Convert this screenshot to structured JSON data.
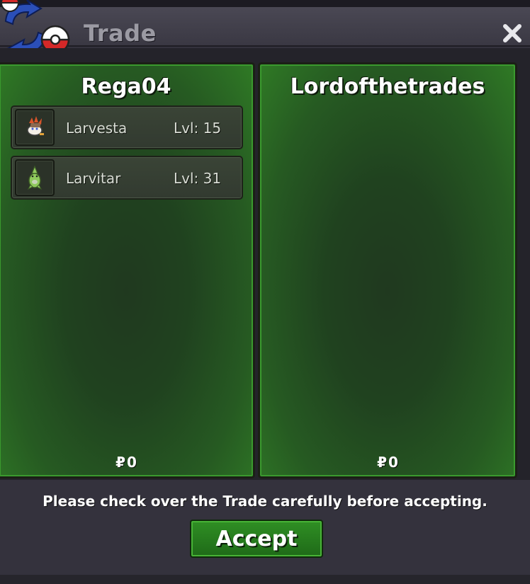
{
  "window": {
    "title": "Trade",
    "close_icon": "close-icon",
    "logo_icon": "trade-exchange-icon"
  },
  "left_panel": {
    "player_name": "Rega04",
    "pokemon": [
      {
        "name": "Larvesta",
        "level": "Lvl: 15",
        "icon": "larvesta-sprite-icon"
      },
      {
        "name": "Larvitar",
        "level": "Lvl: 31",
        "icon": "larvitar-sprite-icon"
      }
    ],
    "money_symbol": "₽",
    "money": "0"
  },
  "right_panel": {
    "player_name": "Lordofthetrades",
    "pokemon": [],
    "money_symbol": "₽",
    "money": "0"
  },
  "footer": {
    "notice": "Please check over the Trade carefully before accepting.",
    "accept_label": "Accept"
  },
  "colors": {
    "panel_green": "#2f7a25",
    "button_green": "#2f8f24",
    "background": "#34323d"
  }
}
